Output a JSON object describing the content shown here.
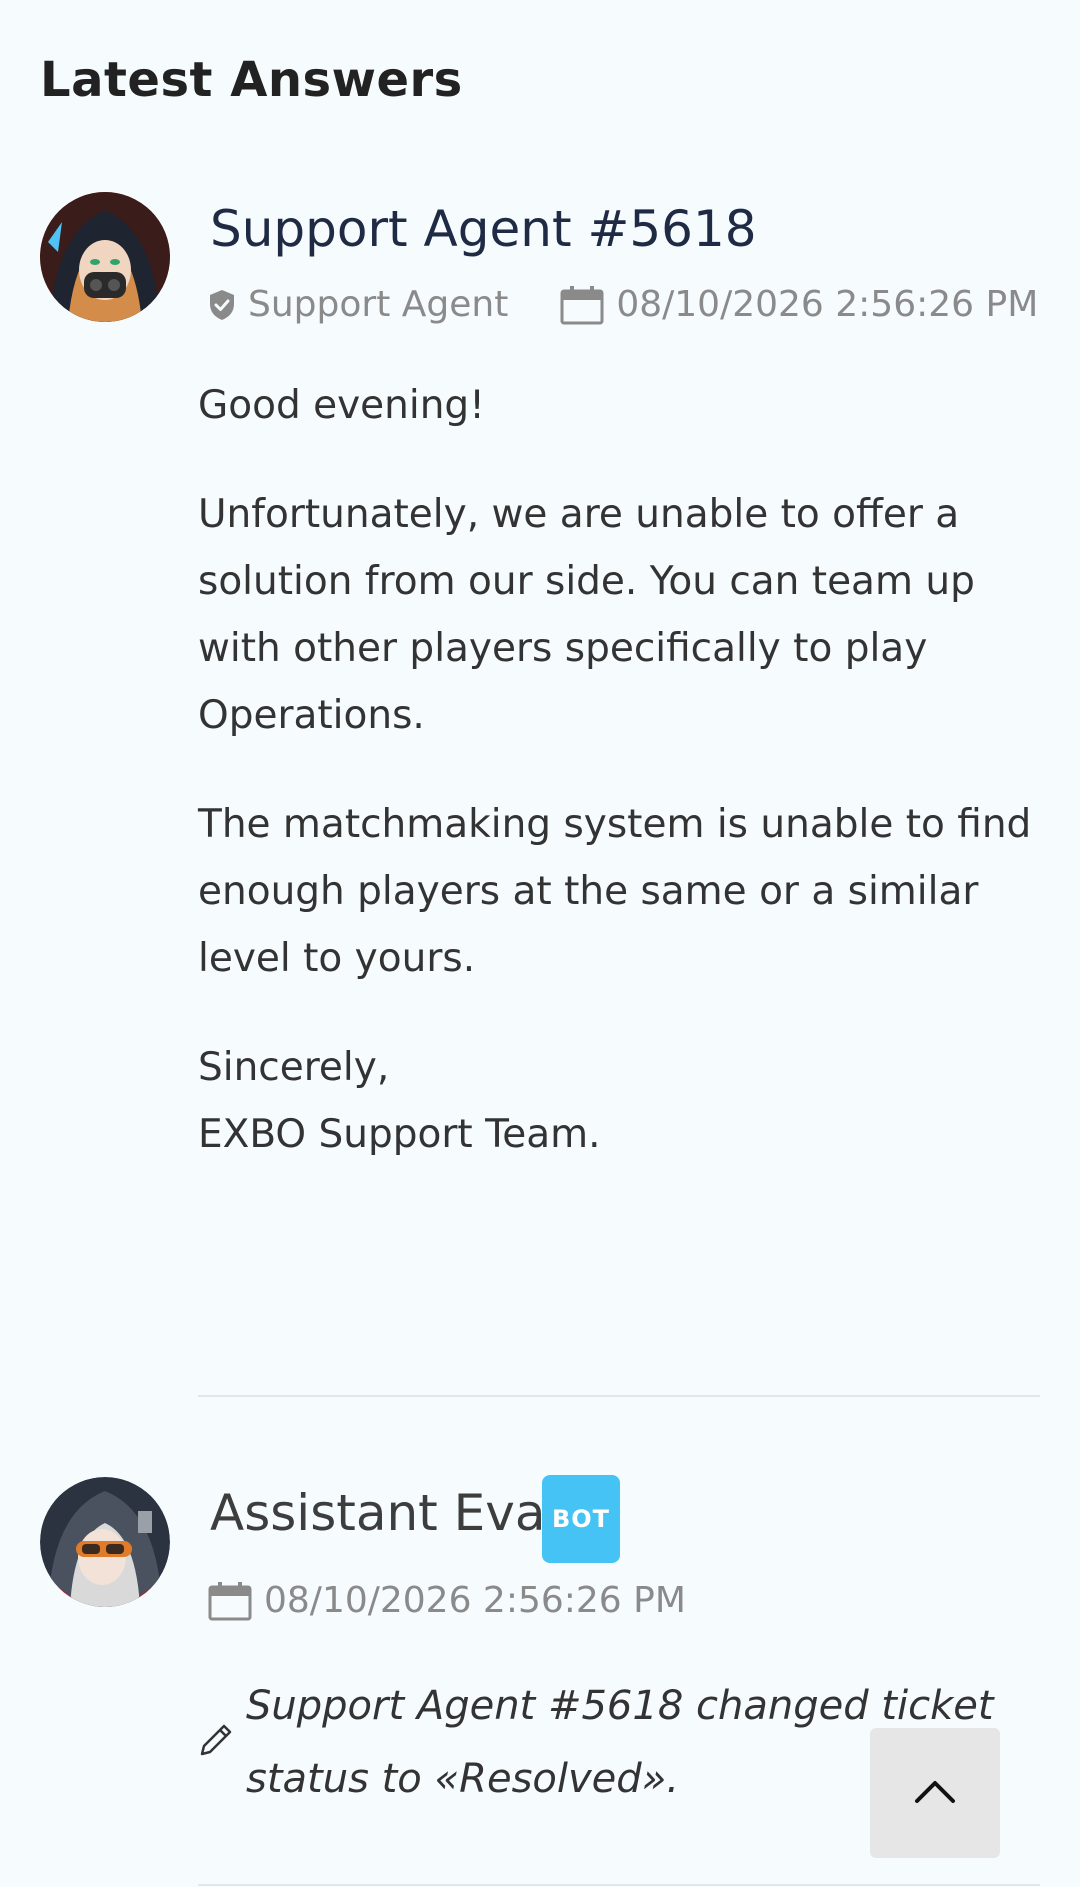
{
  "section": {
    "title": "Latest Answers"
  },
  "answers": [
    {
      "author": "Support Agent #5618",
      "role": "Support Agent",
      "timestamp": "08/10/2026 2:56:26 PM",
      "paragraphs": [
        "Good evening!",
        "Unfortunately, we are unable to offer a solution from our side. You can team up with other players specifically to play Operations.",
        "The matchmaking system is unable to find enough players at the same or a similar level to yours.",
        "Sincerely,",
        "EXBO Support Team."
      ]
    },
    {
      "author": "Assistant Eva",
      "badge": "BOT",
      "timestamp": "08/10/2026 2:56:26 PM",
      "status_message": "Support Agent #5618 changed ticket status to «Resolved»."
    }
  ],
  "icons": {
    "role": "shield-check-icon",
    "date": "calendar-icon",
    "status": "pencil-icon",
    "scroll": "chevron-up-icon"
  },
  "colors": {
    "background": "#f6fbfe",
    "bot_badge": "#45c3f5",
    "agent_name": "#1f2a44",
    "meta_text": "#8a8a8a"
  }
}
